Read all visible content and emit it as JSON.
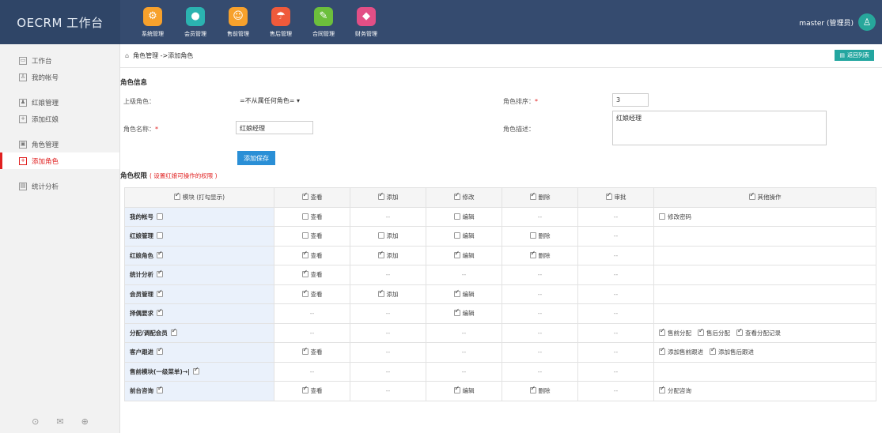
{
  "app": {
    "title": "OECRM 工作台"
  },
  "modules": [
    {
      "label": "系统管理",
      "icon": "gear-icon",
      "color": "#f7a12c",
      "glyph": "⚙"
    },
    {
      "label": "会员管理",
      "icon": "person-icon",
      "color": "#2bb3b0",
      "glyph": "●"
    },
    {
      "label": "售前管理",
      "icon": "smiley-icon",
      "color": "#f7a12c",
      "glyph": "☺"
    },
    {
      "label": "售后管理",
      "icon": "umbrella-icon",
      "color": "#ef5a3b",
      "glyph": "☂"
    },
    {
      "label": "合同管理",
      "icon": "edit-icon",
      "color": "#6cbf3c",
      "glyph": "✎"
    },
    {
      "label": "财务管理",
      "icon": "gift-icon",
      "color": "#e24f86",
      "glyph": "◆"
    }
  ],
  "user": {
    "name": "master (管理员)"
  },
  "sidebar": {
    "items": [
      {
        "label": "工作台",
        "icon": "desktop-icon",
        "glyph": "▭"
      },
      {
        "label": "我的帐号",
        "icon": "user-icon",
        "glyph": "♙"
      },
      {
        "label": "红娘管理",
        "icon": "people-icon",
        "glyph": "♟"
      },
      {
        "label": "添加红娘",
        "icon": "add-icon",
        "glyph": "+"
      },
      {
        "label": "角色管理",
        "icon": "role-icon",
        "glyph": "▣"
      },
      {
        "label": "添加角色",
        "icon": "add-role-icon",
        "glyph": "+"
      },
      {
        "label": "统计分析",
        "icon": "chart-icon",
        "glyph": "▤"
      }
    ],
    "active": 5
  },
  "breadcrumb": {
    "text": "角色管理 ->添加角色"
  },
  "back_button": "返回列表",
  "role_info": {
    "section_title": "角色信息",
    "parent_label": "上级角色：",
    "parent_value": "=不从属任何角色= ▾",
    "order_label": "角色排序：",
    "order_value": "3",
    "name_label": "角色名称：",
    "name_value": "红娘经理",
    "desc_label": "角色描述：",
    "desc_value": "红娘经理",
    "required_mark": "*",
    "save_button": "添加保存"
  },
  "permissions": {
    "title": "角色权限",
    "hint": "( 设置红娘可操作的权限 )",
    "headers": [
      "模块 (打勾显示)",
      "查看",
      "添加",
      "修改",
      "删除",
      "审批",
      "其他操作"
    ],
    "rows": [
      {
        "module": "我的帐号",
        "on": false,
        "cells": [
          {
            "t": "查看",
            "on": false
          },
          null,
          {
            "t": "编辑",
            "on": false
          },
          null,
          null
        ],
        "ops": [
          {
            "t": "修改密码",
            "on": false
          }
        ]
      },
      {
        "module": "红娘管理",
        "on": false,
        "cells": [
          {
            "t": "查看",
            "on": false
          },
          {
            "t": "添加",
            "on": false
          },
          {
            "t": "编辑",
            "on": false
          },
          {
            "t": "删除",
            "on": false
          },
          null
        ],
        "ops": []
      },
      {
        "module": "红娘角色",
        "on": true,
        "cells": [
          {
            "t": "查看",
            "on": true
          },
          {
            "t": "添加",
            "on": true
          },
          {
            "t": "编辑",
            "on": true
          },
          {
            "t": "删除",
            "on": true
          },
          null
        ],
        "ops": []
      },
      {
        "module": "统计分析",
        "on": true,
        "cells": [
          {
            "t": "查看",
            "on": true
          },
          null,
          null,
          null,
          null
        ],
        "ops": []
      },
      {
        "module": "会员管理",
        "on": true,
        "cells": [
          {
            "t": "查看",
            "on": true
          },
          {
            "t": "添加",
            "on": true
          },
          {
            "t": "编辑",
            "on": true
          },
          null,
          null
        ],
        "ops": []
      },
      {
        "module": "择偶要求",
        "on": true,
        "cells": [
          null,
          null,
          {
            "t": "编辑",
            "on": true
          },
          null,
          null
        ],
        "ops": []
      },
      {
        "module": "分配/调配会员",
        "on": true,
        "cells": [
          null,
          null,
          null,
          null,
          null
        ],
        "ops": [
          {
            "t": "售前分配",
            "on": true
          },
          {
            "t": "售后分配",
            "on": true
          },
          {
            "t": "查看分配记录",
            "on": true
          }
        ]
      },
      {
        "module": "客户跟进",
        "on": true,
        "cells": [
          {
            "t": "查看",
            "on": true
          },
          null,
          null,
          null,
          null
        ],
        "ops": [
          {
            "t": "添加售前跟进",
            "on": true
          },
          {
            "t": "添加售后跟进",
            "on": true
          }
        ]
      },
      {
        "module": "售前模块(一级菜单)→|",
        "on": true,
        "cells": [
          null,
          null,
          null,
          null,
          null
        ],
        "ops": []
      },
      {
        "module": "前台咨询",
        "on": true,
        "cells": [
          {
            "t": "查看",
            "on": true
          },
          null,
          {
            "t": "编辑",
            "on": true
          },
          {
            "t": "删除",
            "on": true
          },
          null
        ],
        "ops": [
          {
            "t": "分配咨询",
            "on": true
          }
        ]
      }
    ],
    "dash": "--"
  }
}
